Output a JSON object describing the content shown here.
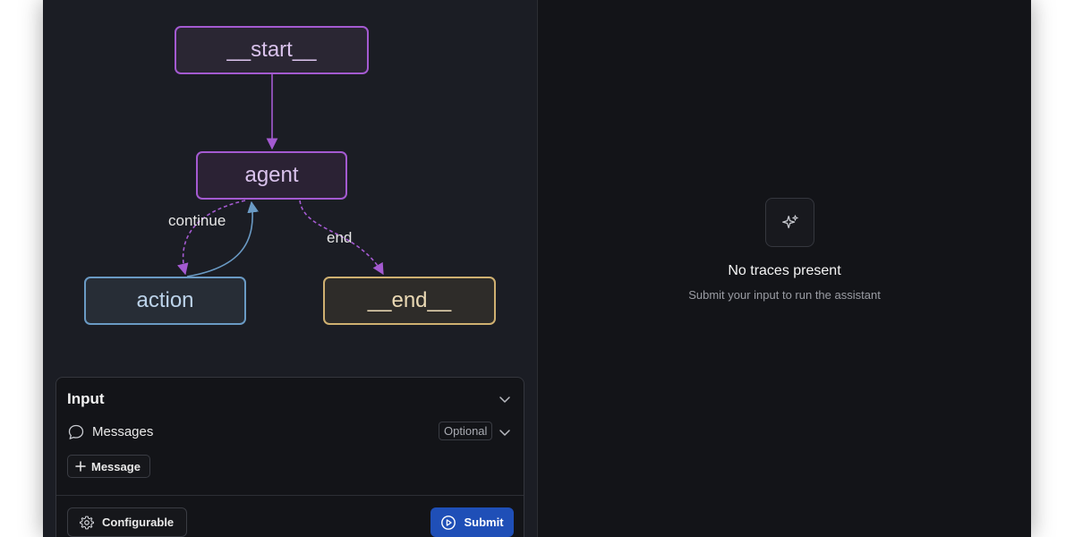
{
  "graph": {
    "nodes": {
      "start": "__start__",
      "agent": "agent",
      "action": "action",
      "end": "__end__"
    },
    "edges": {
      "continue_label": "continue",
      "end_label": "end"
    }
  },
  "input_panel": {
    "title": "Input",
    "messages_label": "Messages",
    "optional_badge": "Optional",
    "add_message_label": "Message",
    "configurable_label": "Configurable",
    "submit_label": "Submit"
  },
  "traces": {
    "title": "No traces present",
    "subtitle": "Submit your input to run the assistant"
  },
  "colors": {
    "accent_purple": "#a45ad1",
    "accent_blue": "#6a9ac4",
    "accent_gold": "#cfb071",
    "submit_blue": "#1f4fb7"
  },
  "icons": {
    "collapse": "chevron-down-icon",
    "messages": "chat-bubble-icon",
    "add": "plus-icon",
    "configurable": "gear-icon",
    "submit": "play-circle-icon",
    "empty_state": "sparkle-icon"
  }
}
